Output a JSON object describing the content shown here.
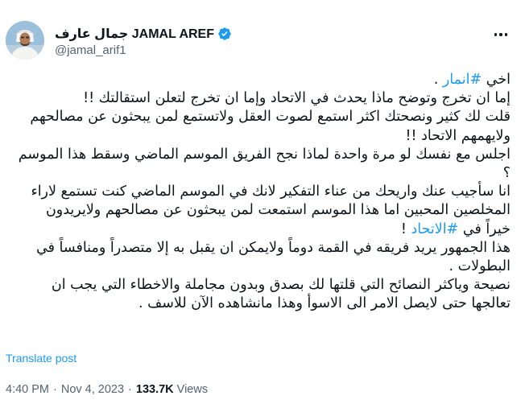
{
  "author": {
    "display_name": "جمال عارف JAMAL AREF",
    "handle": "@jamal_arif1",
    "verified": true
  },
  "tweet": {
    "lines": [
      {
        "text_before": "اخي ",
        "hashtag": "#انمار",
        "text_after": " ."
      },
      {
        "text": "إما ان تخرج وتوضح ماذا يحدث في الاتحاد وإما ان تخرج لتعلن  استقالتك !!"
      },
      {
        "text": "قلت لك كثير ونصحتك اكثر استمع لصوت العقل ولاتستمع لمن يبحثون عن مصالحهم"
      },
      {
        "text": "ولايهمهم الاتحاد !!"
      },
      {
        "text": "اجلس مع نفسك لو مرة واحدة لماذا نجح الفريق الموسم الماضي وسقط هذا الموسم"
      },
      {
        "text": "؟"
      },
      {
        "text": "انا سأجيب عنك واريحك من عناء التفكير لانك في الموسم الماضي كنت تستمع لاراء"
      },
      {
        "text": "المخلصين المحبين اما هذا الموسم استمعت لمن يبحثون عن مصالحهم ولايريدون"
      },
      {
        "text_before": "خيراً في ",
        "hashtag": "#الاتحاد",
        "text_after": " !"
      },
      {
        "text": "هذا الجمهور يريد فريقه في القمة دوماً ولايمكن ان يقبل به إلا متصدراً ومنافساً في"
      },
      {
        "text": "البطولات ."
      },
      {
        "text": "نصيحة وياكثر النصائح التي قلتها لك بصدق وبدون مجاملة والاخطاء التي يجب ان"
      },
      {
        "text": "تعالجها حتى لايصل الامر الى الاسوأ وهذا مانشاهده الآن للاسف ."
      }
    ]
  },
  "translate_label": "Translate post",
  "meta": {
    "time": "4:40 PM",
    "separator": "·",
    "date": "Nov 4, 2023",
    "views_count": "133.7K",
    "views_label": "Views"
  },
  "colors": {
    "accent": "#1d9bf0",
    "text": "#0f1419",
    "secondary": "#536471"
  }
}
